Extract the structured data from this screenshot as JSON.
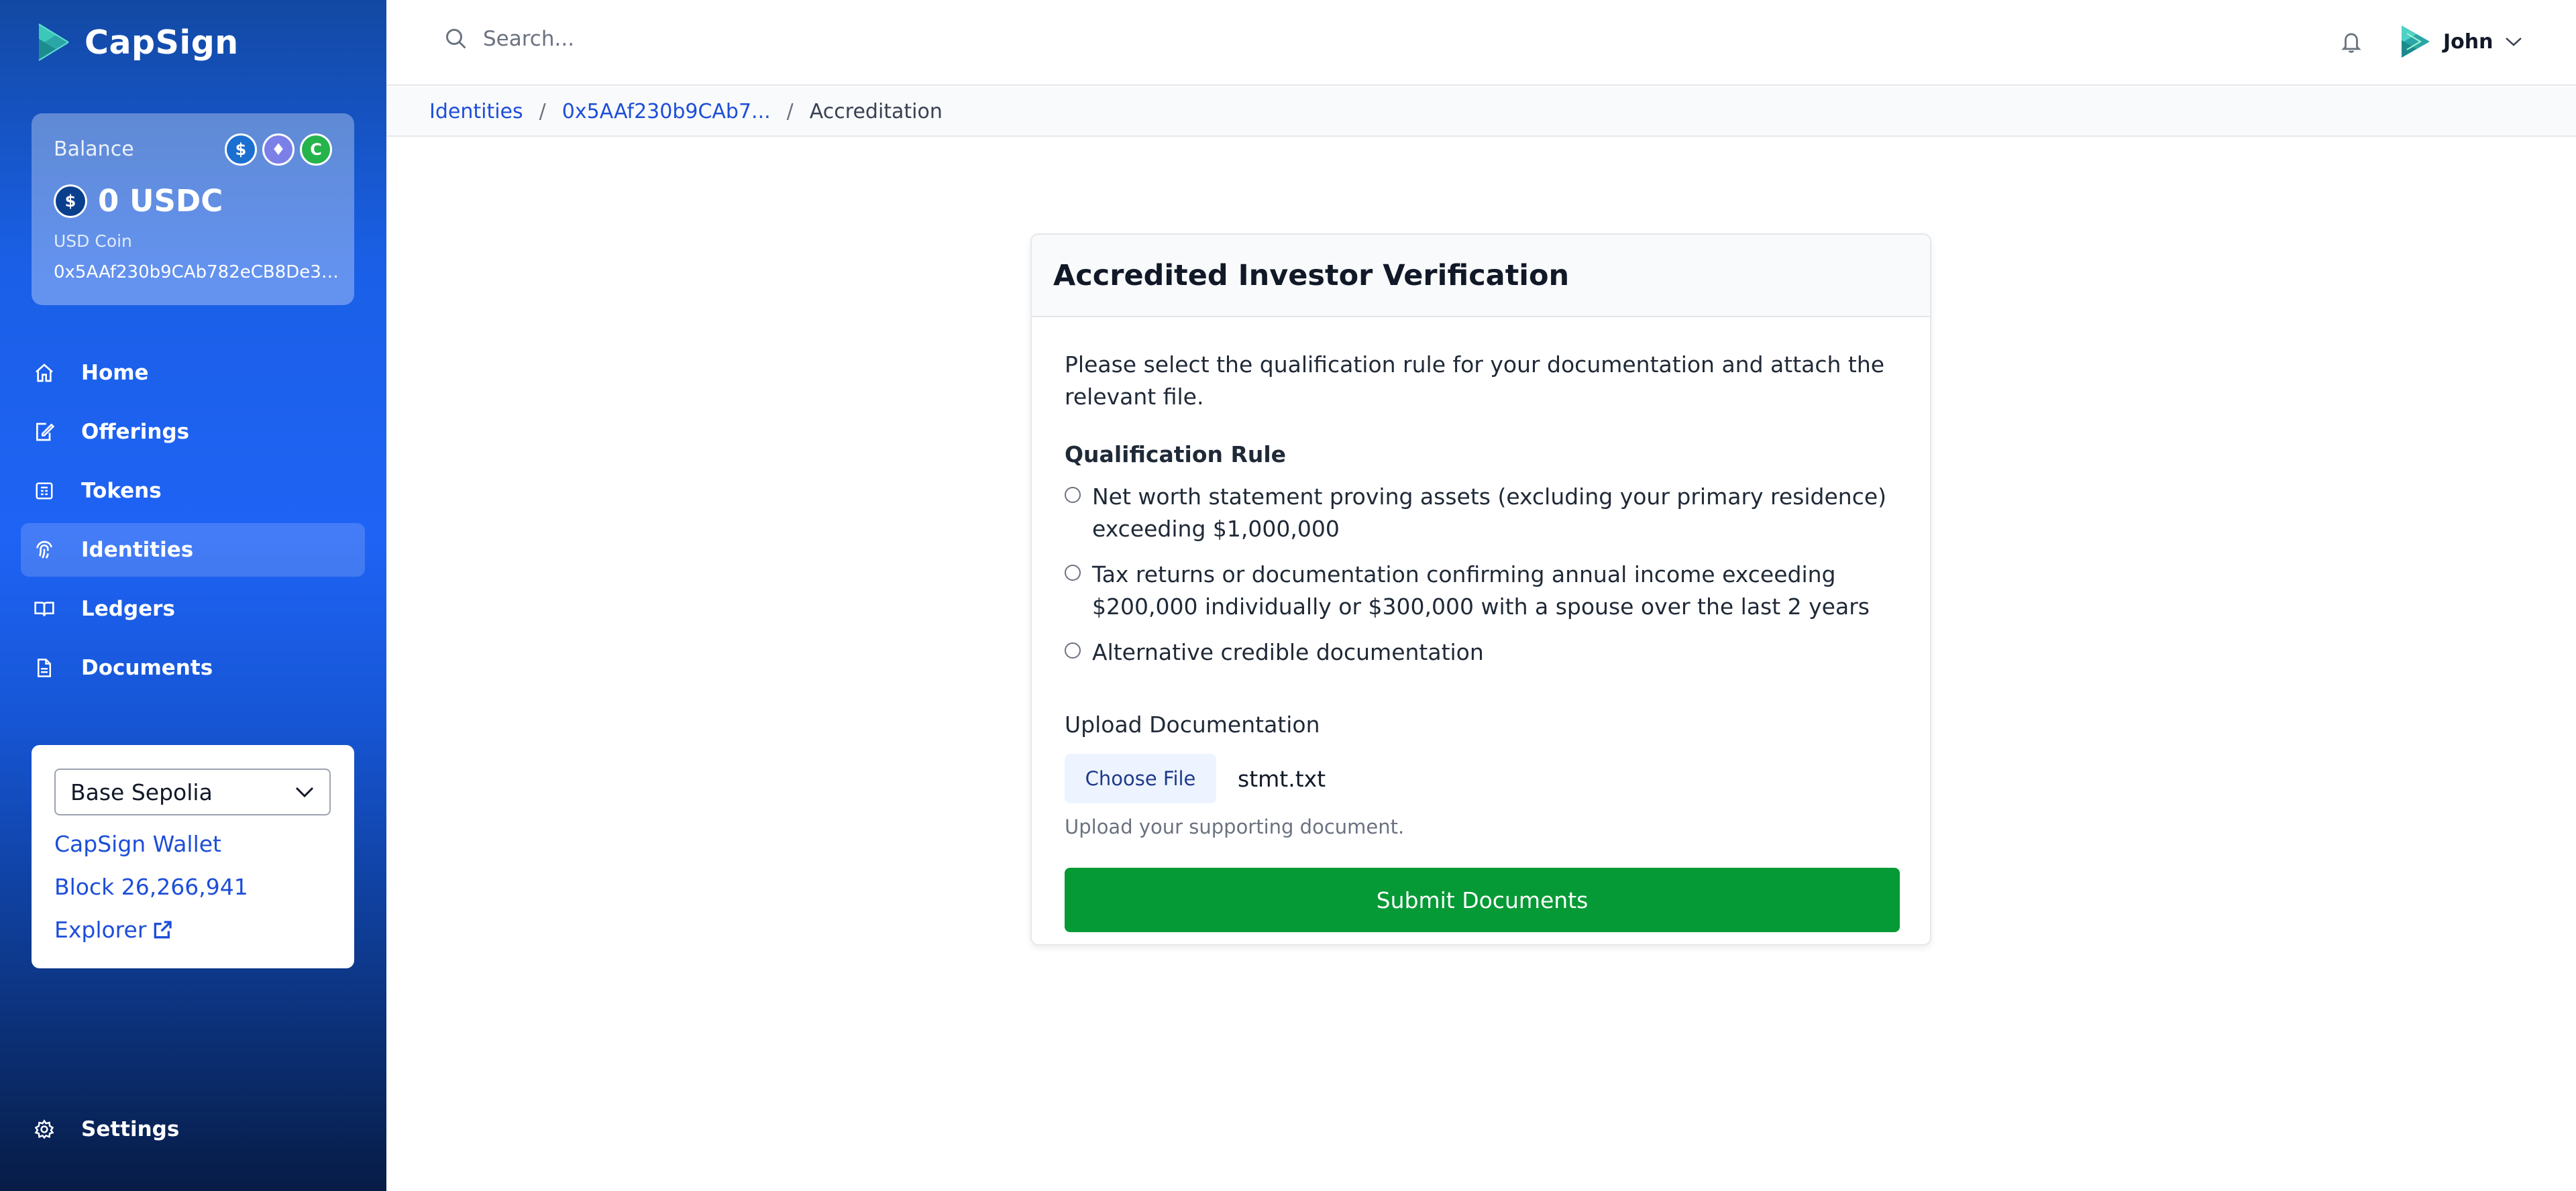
{
  "app": {
    "name": "CapSign"
  },
  "balance": {
    "label": "Balance",
    "amount": "0 USDC",
    "currency_name": "USD Coin",
    "address": "0x5AAf230b9CAb782eCB8De30..."
  },
  "colors": {
    "sidebar_top": "#1249a3",
    "sidebar_bottom": "#071c46",
    "link": "#1d4ed8",
    "submit": "#059a35"
  },
  "nav": {
    "items": [
      {
        "label": "Home",
        "icon": "home-icon"
      },
      {
        "label": "Offerings",
        "icon": "offerings-icon"
      },
      {
        "label": "Tokens",
        "icon": "tokens-icon"
      },
      {
        "label": "Identities",
        "icon": "fingerprint-icon",
        "active": true
      },
      {
        "label": "Ledgers",
        "icon": "book-icon"
      },
      {
        "label": "Documents",
        "icon": "document-icon"
      }
    ],
    "settings_label": "Settings"
  },
  "network": {
    "selected": "Base Sepolia",
    "wallet_label": "CapSign Wallet",
    "block_label": "Block 26,266,941",
    "explorer_label": "Explorer"
  },
  "header": {
    "search_placeholder": "Search...",
    "user_name": "John"
  },
  "breadcrumb": {
    "items": [
      "Identities",
      "0x5AAf230b9CAb7...",
      "Accreditation"
    ]
  },
  "form": {
    "title": "Accredited Investor Verification",
    "intro": "Please select the qualification rule for your documentation and attach the relevant file.",
    "rule_heading": "Qualification Rule",
    "rules": [
      "Net worth statement proving assets (excluding your primary residence) exceeding $1,000,000",
      "Tax returns or documentation confirming annual income exceeding $200,000 individually or $300,000 with a spouse over the last 2 years",
      "Alternative credible documentation"
    ],
    "upload_label": "Upload Documentation",
    "choose_file_label": "Choose File",
    "file_name": "stmt.txt",
    "help_text": "Upload your supporting document.",
    "submit_label": "Submit Documents"
  }
}
